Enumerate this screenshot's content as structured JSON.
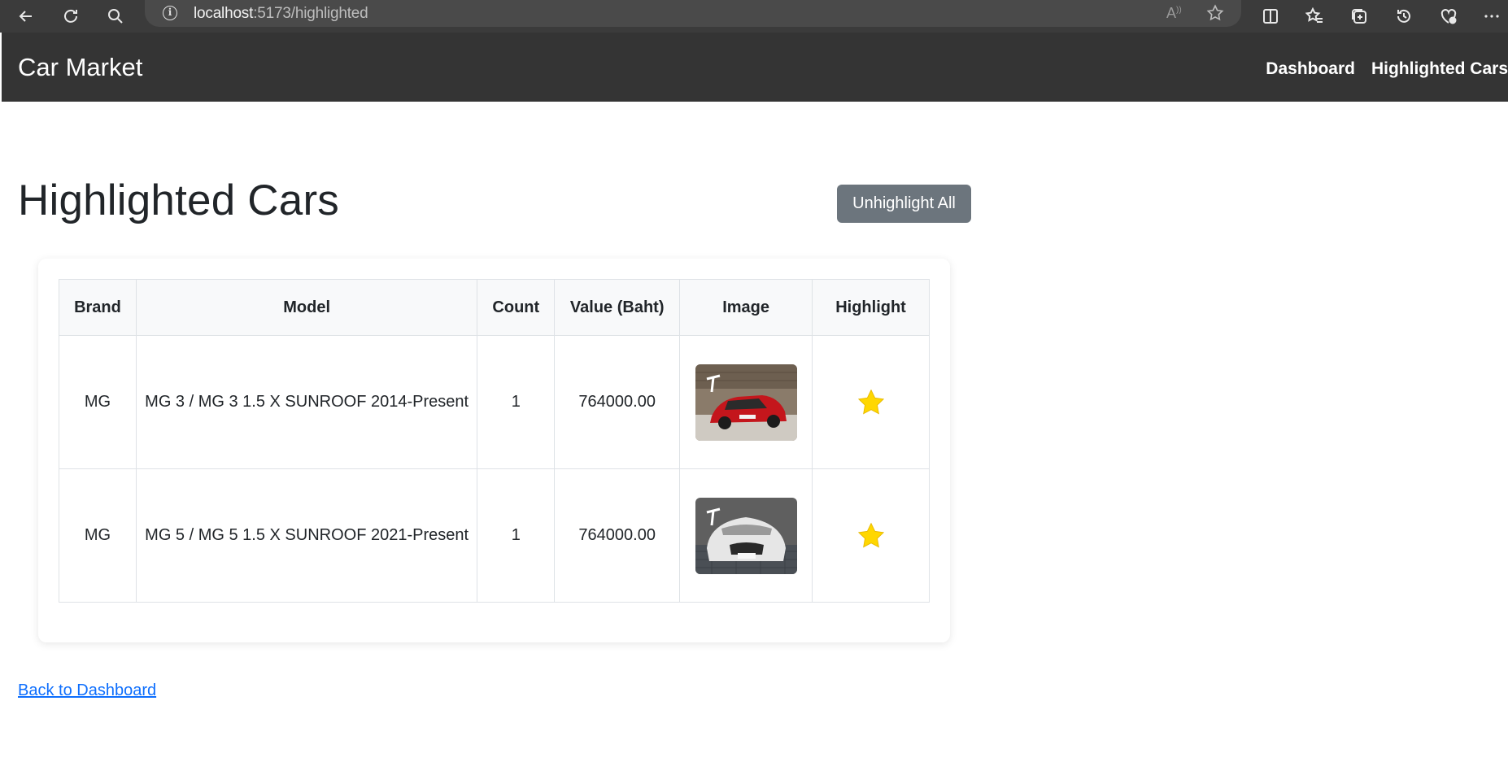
{
  "browser": {
    "url_host": "localhost",
    "url_path": ":5173/highlighted"
  },
  "navbar": {
    "brand": "Car Market",
    "links": [
      "Dashboard",
      "Highlighted Cars"
    ]
  },
  "page": {
    "title": "Highlighted Cars",
    "unhighlight_button": "Unhighlight All",
    "back_link": "Back to Dashboard"
  },
  "table": {
    "headers": [
      "Brand",
      "Model",
      "Count",
      "Value (Baht)",
      "Image",
      "Highlight"
    ],
    "rows": [
      {
        "brand": "MG",
        "model": "MG 3 / MG 3 1.5 X SUNROOF 2014-Present",
        "count": "1",
        "value": "764000.00",
        "image": "red-car-photo",
        "highlighted": true
      },
      {
        "brand": "MG",
        "model": "MG 5 / MG 5 1.5 X SUNROOF 2021-Present",
        "count": "1",
        "value": "764000.00",
        "image": "white-car-photo",
        "highlighted": true
      }
    ]
  },
  "colors": {
    "navbar": "#343434",
    "button_secondary": "#6c757d",
    "star": "#ffd700",
    "link": "#0d6efd"
  }
}
